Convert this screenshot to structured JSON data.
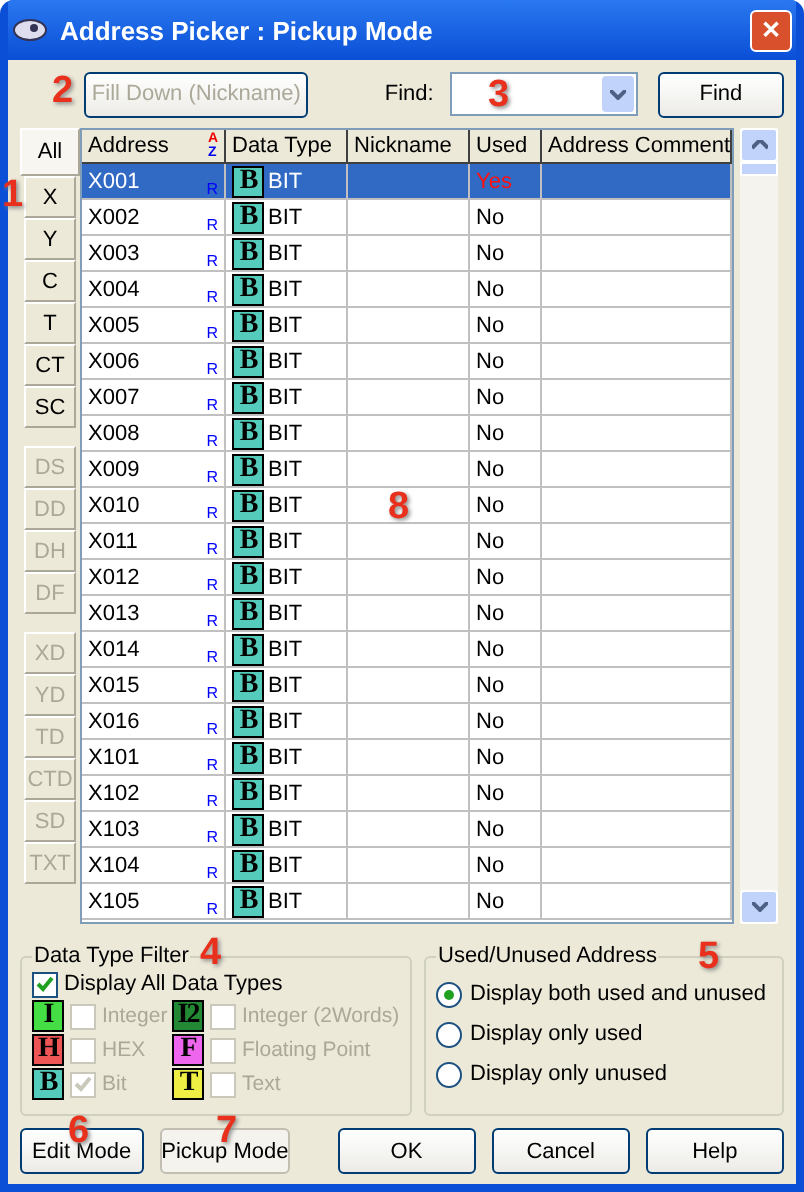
{
  "window": {
    "title": "Address Picker : Pickup Mode",
    "close": "✕"
  },
  "toolbar": {
    "fill_down": {
      "label": "Fill Down (Nickname)",
      "disabled": true
    },
    "find_label": "Find:",
    "find_button": "Find"
  },
  "tab_groups": [
    [
      {
        "label": "All",
        "selected": true,
        "disabled": false
      },
      {
        "label": "X",
        "selected": false,
        "disabled": false
      },
      {
        "label": "Y",
        "selected": false,
        "disabled": false
      },
      {
        "label": "C",
        "selected": false,
        "disabled": false
      },
      {
        "label": "T",
        "selected": false,
        "disabled": false
      },
      {
        "label": "CT",
        "selected": false,
        "disabled": false
      },
      {
        "label": "SC",
        "selected": false,
        "disabled": false
      }
    ],
    [
      {
        "label": "DS",
        "selected": false,
        "disabled": true
      },
      {
        "label": "DD",
        "selected": false,
        "disabled": true
      },
      {
        "label": "DH",
        "selected": false,
        "disabled": true
      },
      {
        "label": "DF",
        "selected": false,
        "disabled": true
      }
    ],
    [
      {
        "label": "XD",
        "selected": false,
        "disabled": true
      },
      {
        "label": "YD",
        "selected": false,
        "disabled": true
      },
      {
        "label": "TD",
        "selected": false,
        "disabled": true
      },
      {
        "label": "CTD",
        "selected": false,
        "disabled": true
      },
      {
        "label": "SD",
        "selected": false,
        "disabled": true
      },
      {
        "label": "TXT",
        "selected": false,
        "disabled": true
      }
    ]
  ],
  "table": {
    "columns": [
      "Address",
      "Data Type",
      "Nickname",
      "Used",
      "Address Comment"
    ],
    "sort_icon_top": "A",
    "sort_icon_bottom": "Z",
    "rows": [
      {
        "address": "X001",
        "flag": "R",
        "type_icon": "B",
        "data_type": "BIT",
        "used": "Yes",
        "selected": true
      },
      {
        "address": "X002",
        "flag": "R",
        "type_icon": "B",
        "data_type": "BIT",
        "used": "No",
        "selected": false
      },
      {
        "address": "X003",
        "flag": "R",
        "type_icon": "B",
        "data_type": "BIT",
        "used": "No",
        "selected": false
      },
      {
        "address": "X004",
        "flag": "R",
        "type_icon": "B",
        "data_type": "BIT",
        "used": "No",
        "selected": false
      },
      {
        "address": "X005",
        "flag": "R",
        "type_icon": "B",
        "data_type": "BIT",
        "used": "No",
        "selected": false
      },
      {
        "address": "X006",
        "flag": "R",
        "type_icon": "B",
        "data_type": "BIT",
        "used": "No",
        "selected": false
      },
      {
        "address": "X007",
        "flag": "R",
        "type_icon": "B",
        "data_type": "BIT",
        "used": "No",
        "selected": false
      },
      {
        "address": "X008",
        "flag": "R",
        "type_icon": "B",
        "data_type": "BIT",
        "used": "No",
        "selected": false
      },
      {
        "address": "X009",
        "flag": "R",
        "type_icon": "B",
        "data_type": "BIT",
        "used": "No",
        "selected": false
      },
      {
        "address": "X010",
        "flag": "R",
        "type_icon": "B",
        "data_type": "BIT",
        "used": "No",
        "selected": false
      },
      {
        "address": "X011",
        "flag": "R",
        "type_icon": "B",
        "data_type": "BIT",
        "used": "No",
        "selected": false
      },
      {
        "address": "X012",
        "flag": "R",
        "type_icon": "B",
        "data_type": "BIT",
        "used": "No",
        "selected": false
      },
      {
        "address": "X013",
        "flag": "R",
        "type_icon": "B",
        "data_type": "BIT",
        "used": "No",
        "selected": false
      },
      {
        "address": "X014",
        "flag": "R",
        "type_icon": "B",
        "data_type": "BIT",
        "used": "No",
        "selected": false
      },
      {
        "address": "X015",
        "flag": "R",
        "type_icon": "B",
        "data_type": "BIT",
        "used": "No",
        "selected": false
      },
      {
        "address": "X016",
        "flag": "R",
        "type_icon": "B",
        "data_type": "BIT",
        "used": "No",
        "selected": false
      },
      {
        "address": "X101",
        "flag": "R",
        "type_icon": "B",
        "data_type": "BIT",
        "used": "No",
        "selected": false
      },
      {
        "address": "X102",
        "flag": "R",
        "type_icon": "B",
        "data_type": "BIT",
        "used": "No",
        "selected": false
      },
      {
        "address": "X103",
        "flag": "R",
        "type_icon": "B",
        "data_type": "BIT",
        "used": "No",
        "selected": false
      },
      {
        "address": "X104",
        "flag": "R",
        "type_icon": "B",
        "data_type": "BIT",
        "used": "No",
        "selected": false
      },
      {
        "address": "X105",
        "flag": "R",
        "type_icon": "B",
        "data_type": "BIT",
        "used": "No",
        "selected": false
      }
    ]
  },
  "data_type_filter": {
    "title": "Data Type Filter",
    "display_all": {
      "label": "Display All Data Types",
      "checked": true
    },
    "types": [
      {
        "icon": "I",
        "label": "Integer",
        "color": "#44dd44",
        "checked": false
      },
      {
        "icon": "I2",
        "label": "Integer (2Words)",
        "color": "#228833",
        "checked": false
      },
      {
        "icon": "H",
        "label": "HEX",
        "color": "#ee5555",
        "checked": false
      },
      {
        "icon": "F",
        "label": "Floating Point",
        "color": "#ee66ee",
        "checked": false
      },
      {
        "icon": "B",
        "label": "Bit",
        "color": "#55ccbb",
        "checked": true
      },
      {
        "icon": "T",
        "label": "Text",
        "color": "#eeee44",
        "checked": false
      }
    ]
  },
  "used_filter": {
    "title": "Used/Unused Address",
    "options": [
      {
        "label": "Display both used and unused",
        "selected": true
      },
      {
        "label": "Display only used",
        "selected": false
      },
      {
        "label": "Display only unused",
        "selected": false
      }
    ]
  },
  "mode_buttons": [
    {
      "label": "Edit Mode",
      "selected": false
    },
    {
      "label": "Pickup Mode",
      "selected": true
    }
  ],
  "buttons": [
    "OK",
    "Cancel",
    "Help"
  ],
  "annotations": [
    "1",
    "2",
    "3",
    "4",
    "5",
    "6",
    "7",
    "8"
  ]
}
